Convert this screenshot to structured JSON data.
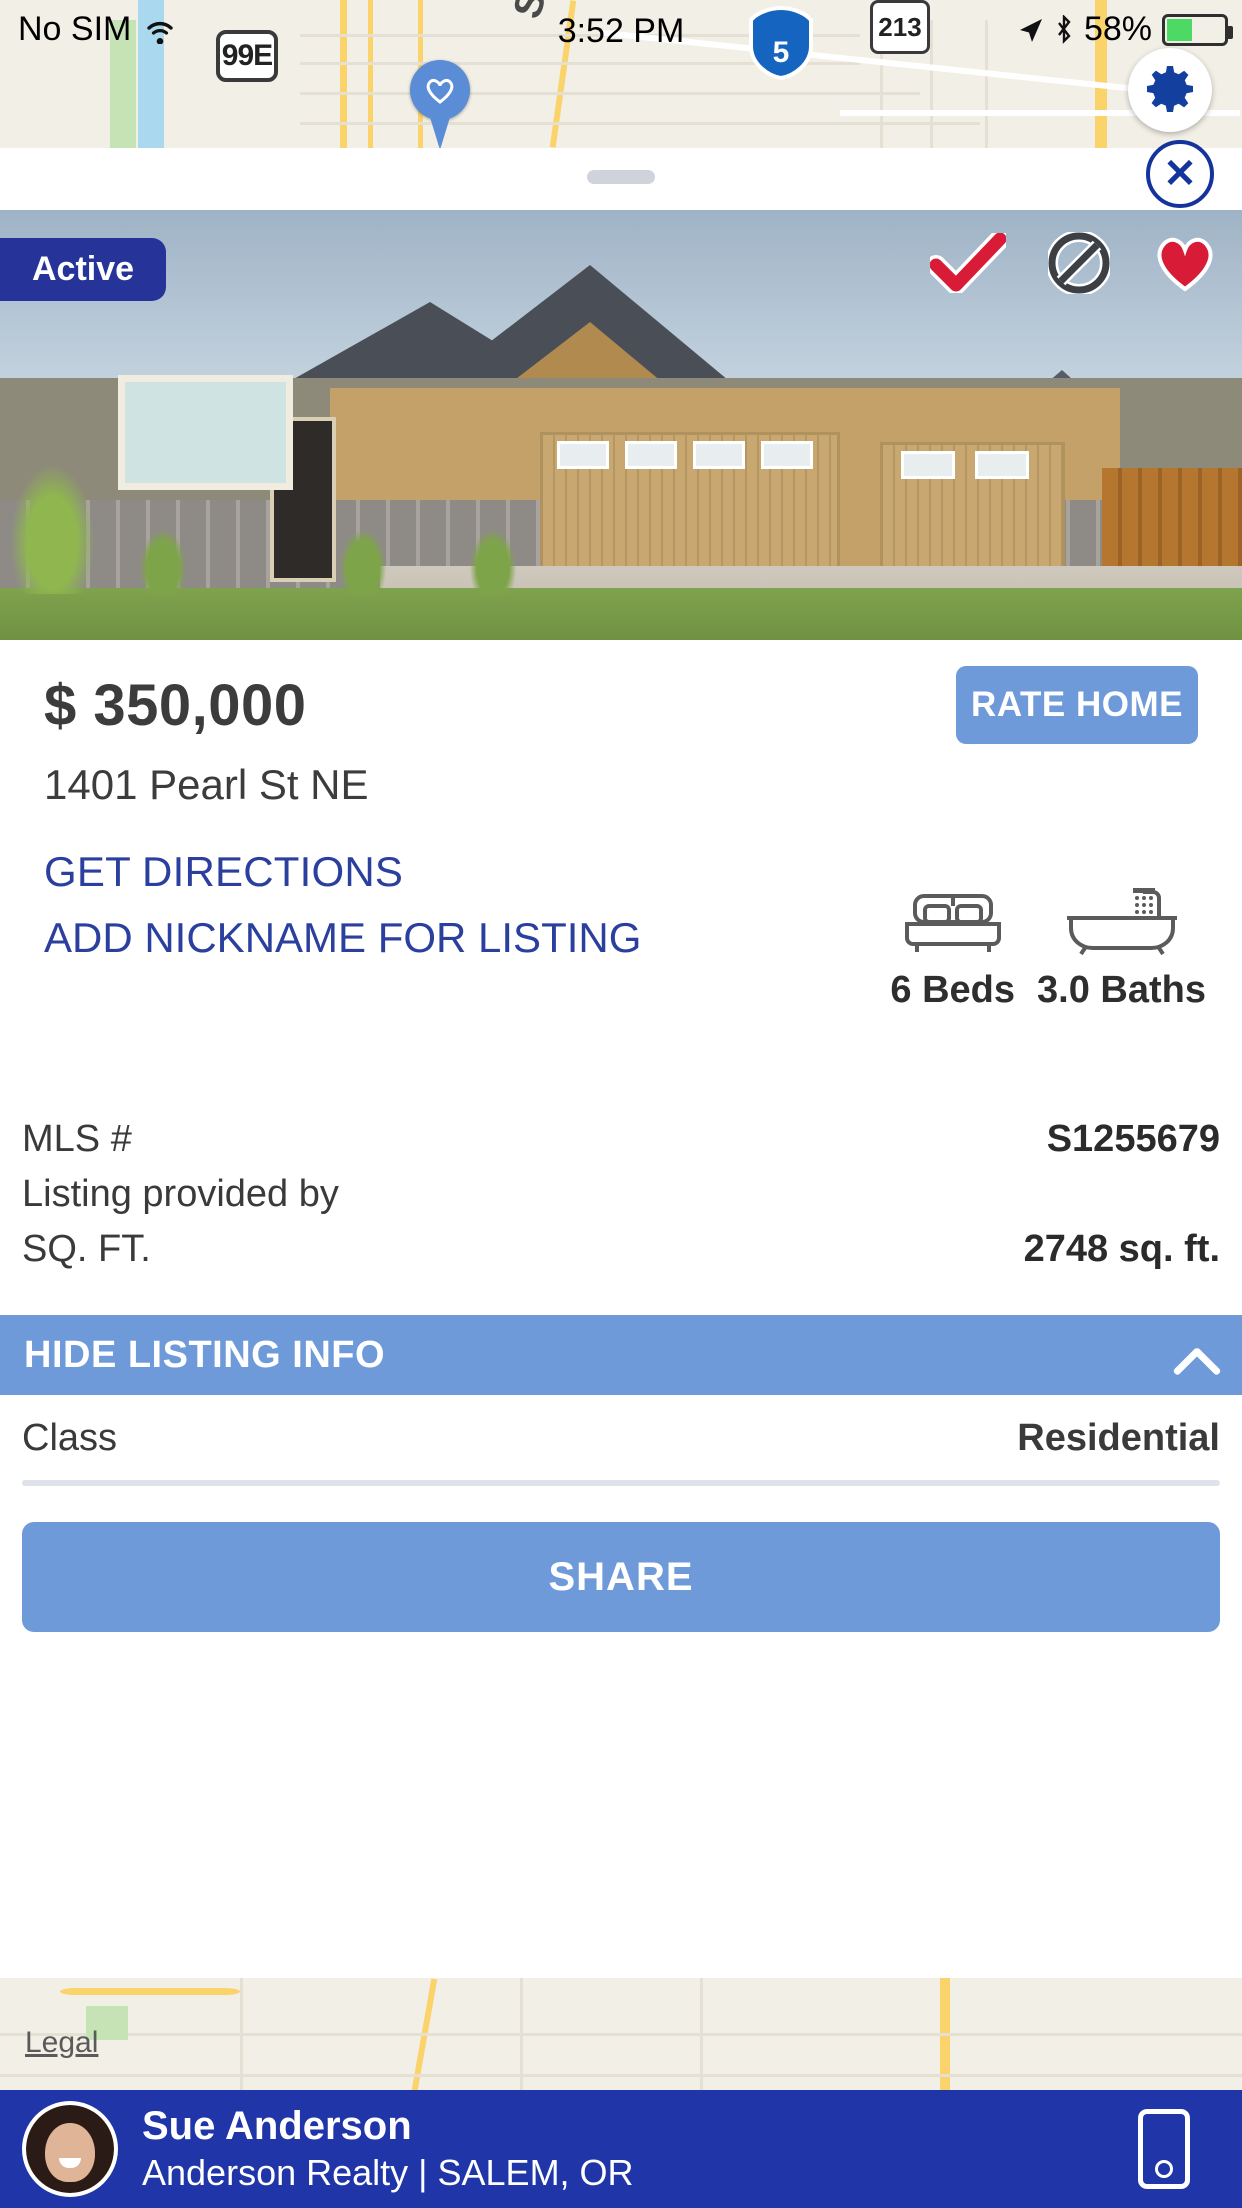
{
  "status_bar": {
    "carrier": "No SIM",
    "wifi_icon": "wifi-icon",
    "time": "3:52 PM",
    "location_icon": "location-arrow-icon",
    "bluetooth_icon": "bluetooth-icon",
    "battery_percent": "58%",
    "battery_icon": "battery-icon"
  },
  "map": {
    "highway_99e": "99E",
    "interstate_5": "5",
    "route_213": "213",
    "street_label": "St NE",
    "pin_icon": "heart-pin-icon",
    "settings_icon": "gear-icon",
    "legal_link": "Legal"
  },
  "sheet": {
    "close_label": "✕",
    "grabber": "drag-handle"
  },
  "photo": {
    "status_badge": "Active",
    "actions": [
      {
        "name": "approve-check-icon",
        "glyph": "✔",
        "color": "#d81c37"
      },
      {
        "name": "reject-prohibited-icon",
        "glyph": "⊘",
        "color": "#3c4045"
      },
      {
        "name": "favorite-heart-icon",
        "glyph": "♥",
        "color": "#d81c37"
      }
    ]
  },
  "listing": {
    "price": "$ 350,000",
    "address": "1401 Pearl St NE",
    "rate_home_label": "RATE HOME",
    "get_directions_label": "GET DIRECTIONS",
    "add_nickname_label": "ADD NICKNAME FOR LISTING",
    "beds_value": "6 Beds",
    "baths_value": "3.0 Baths",
    "bed_icon": "bed-icon",
    "bath_icon": "bathtub-icon"
  },
  "details": {
    "rows": [
      {
        "key": "MLS #",
        "value": "S1255679"
      },
      {
        "key": "Listing provided by",
        "value": ""
      },
      {
        "key": "SQ. FT.",
        "value": "2748 sq. ft."
      }
    ],
    "hide_listing_label": "HIDE LISTING INFO",
    "chevron_icon": "chevron-up-icon",
    "class_key": "Class",
    "class_value": "Residential",
    "share_label": "SHARE"
  },
  "agent": {
    "name": "Sue Anderson",
    "subtitle": "Anderson Realty | SALEM, OR",
    "avatar": "agent-avatar",
    "phone_icon": "mobile-phone-icon"
  },
  "colors": {
    "brand_dark_blue": "#1f35a8",
    "badge_blue": "#26349a",
    "button_blue": "#6f9ada",
    "link_blue": "#2b3f9e",
    "accent_red": "#d81c37",
    "map_bg": "#f2efe6"
  }
}
